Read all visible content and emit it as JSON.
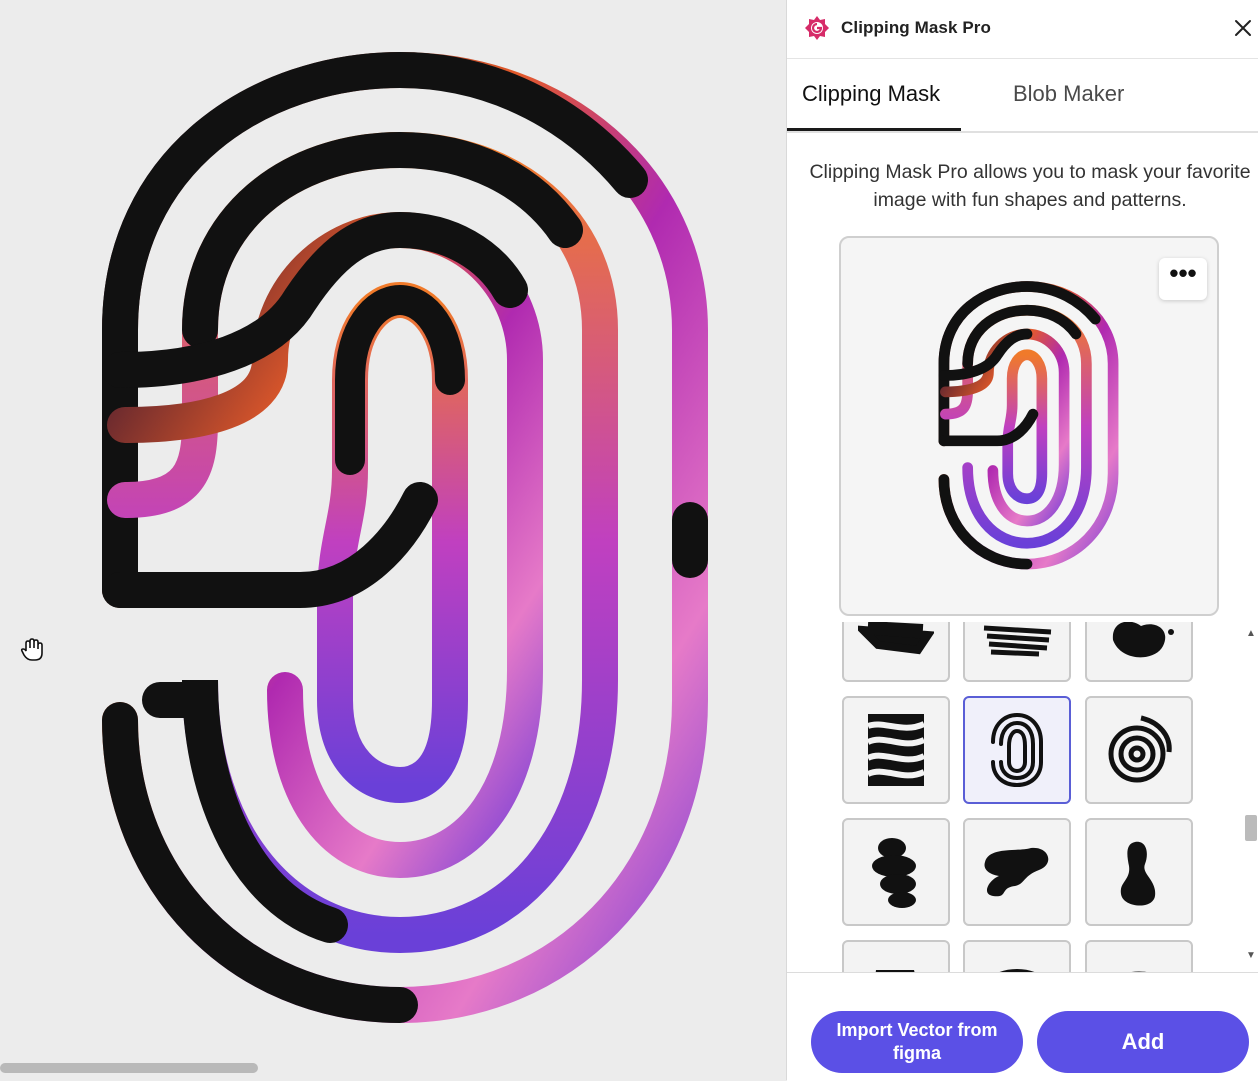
{
  "plugin": {
    "title": "Clipping Mask Pro",
    "brand_color": "#d62b68",
    "accent_color": "#5b50e6"
  },
  "tabs": [
    {
      "label": "Clipping Mask",
      "active": true
    },
    {
      "label": "Blob Maker",
      "active": false
    }
  ],
  "description": "Clipping Mask Pro allows you to mask your favorite image with fun shapes and patterns.",
  "preview": {
    "more_label": "•••"
  },
  "shapes": [
    {
      "icon": "brush-stroke-icon",
      "selected": false
    },
    {
      "icon": "brush-scribble-icon",
      "selected": false
    },
    {
      "icon": "blob-splat-icon",
      "selected": false
    },
    {
      "icon": "zebra-stripes-icon",
      "selected": false
    },
    {
      "icon": "fingerprint-icon",
      "selected": true
    },
    {
      "icon": "spiral-swirl-icon",
      "selected": false
    },
    {
      "icon": "stacked-stones-icon",
      "selected": false
    },
    {
      "icon": "wavy-blob-icon",
      "selected": false
    },
    {
      "icon": "bean-blob-icon",
      "selected": false
    },
    {
      "icon": "blob-shape-icon",
      "selected": false
    },
    {
      "icon": "arc-shape-icon",
      "selected": false
    },
    {
      "icon": "arc-shape-icon",
      "selected": false
    }
  ],
  "buttons": {
    "import": "Import Vector from figma",
    "add": "Add"
  }
}
